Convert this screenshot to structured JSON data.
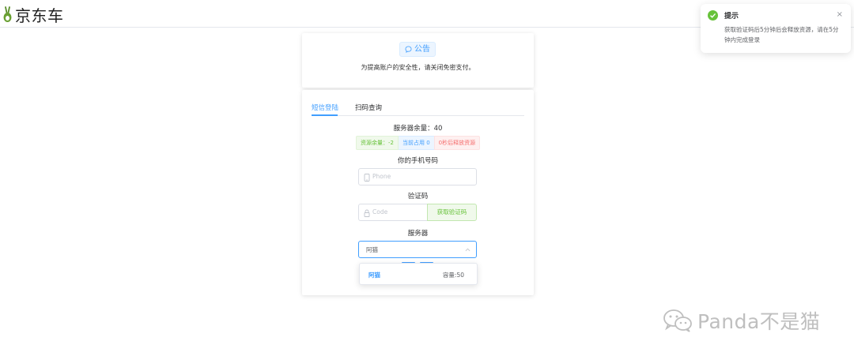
{
  "header": {
    "logo_text": "京东车",
    "logo_icon": "rabbit-logo-icon"
  },
  "notice": {
    "tag_label": "公告",
    "tag_icon": "message-icon",
    "text": "为提高账户的安全性，请关闭免密支付。"
  },
  "login": {
    "tabs": [
      {
        "label": "短信登陆",
        "active": true
      },
      {
        "label": "扫码查询",
        "active": false
      }
    ],
    "server_remaining_label": "服务器余量：40",
    "status": {
      "resources_left": "资源余量：-2",
      "currently_used": "当前占用 0",
      "release": "0秒后释放资源"
    },
    "phone_label": "你的手机号码",
    "phone_placeholder": "Phone",
    "code_label": "验证码",
    "code_placeholder": "Code",
    "get_code_button": "获取验证码",
    "server_label": "服务器",
    "server_selected": "阿猫",
    "dropdown_options": [
      {
        "name": "阿猫",
        "capacity": "容量:50"
      }
    ]
  },
  "toast": {
    "title": "提示",
    "message": "获取验证码后5分钟后会释放资源，请在5分钟内完成登录",
    "close_glyph": "×",
    "icon": "success-check-icon"
  },
  "watermark": {
    "text": "Panda不是猫",
    "icon": "wechat-icon"
  },
  "colors": {
    "primary": "#409eff",
    "success": "#67c23a",
    "danger": "#f56c6c"
  }
}
